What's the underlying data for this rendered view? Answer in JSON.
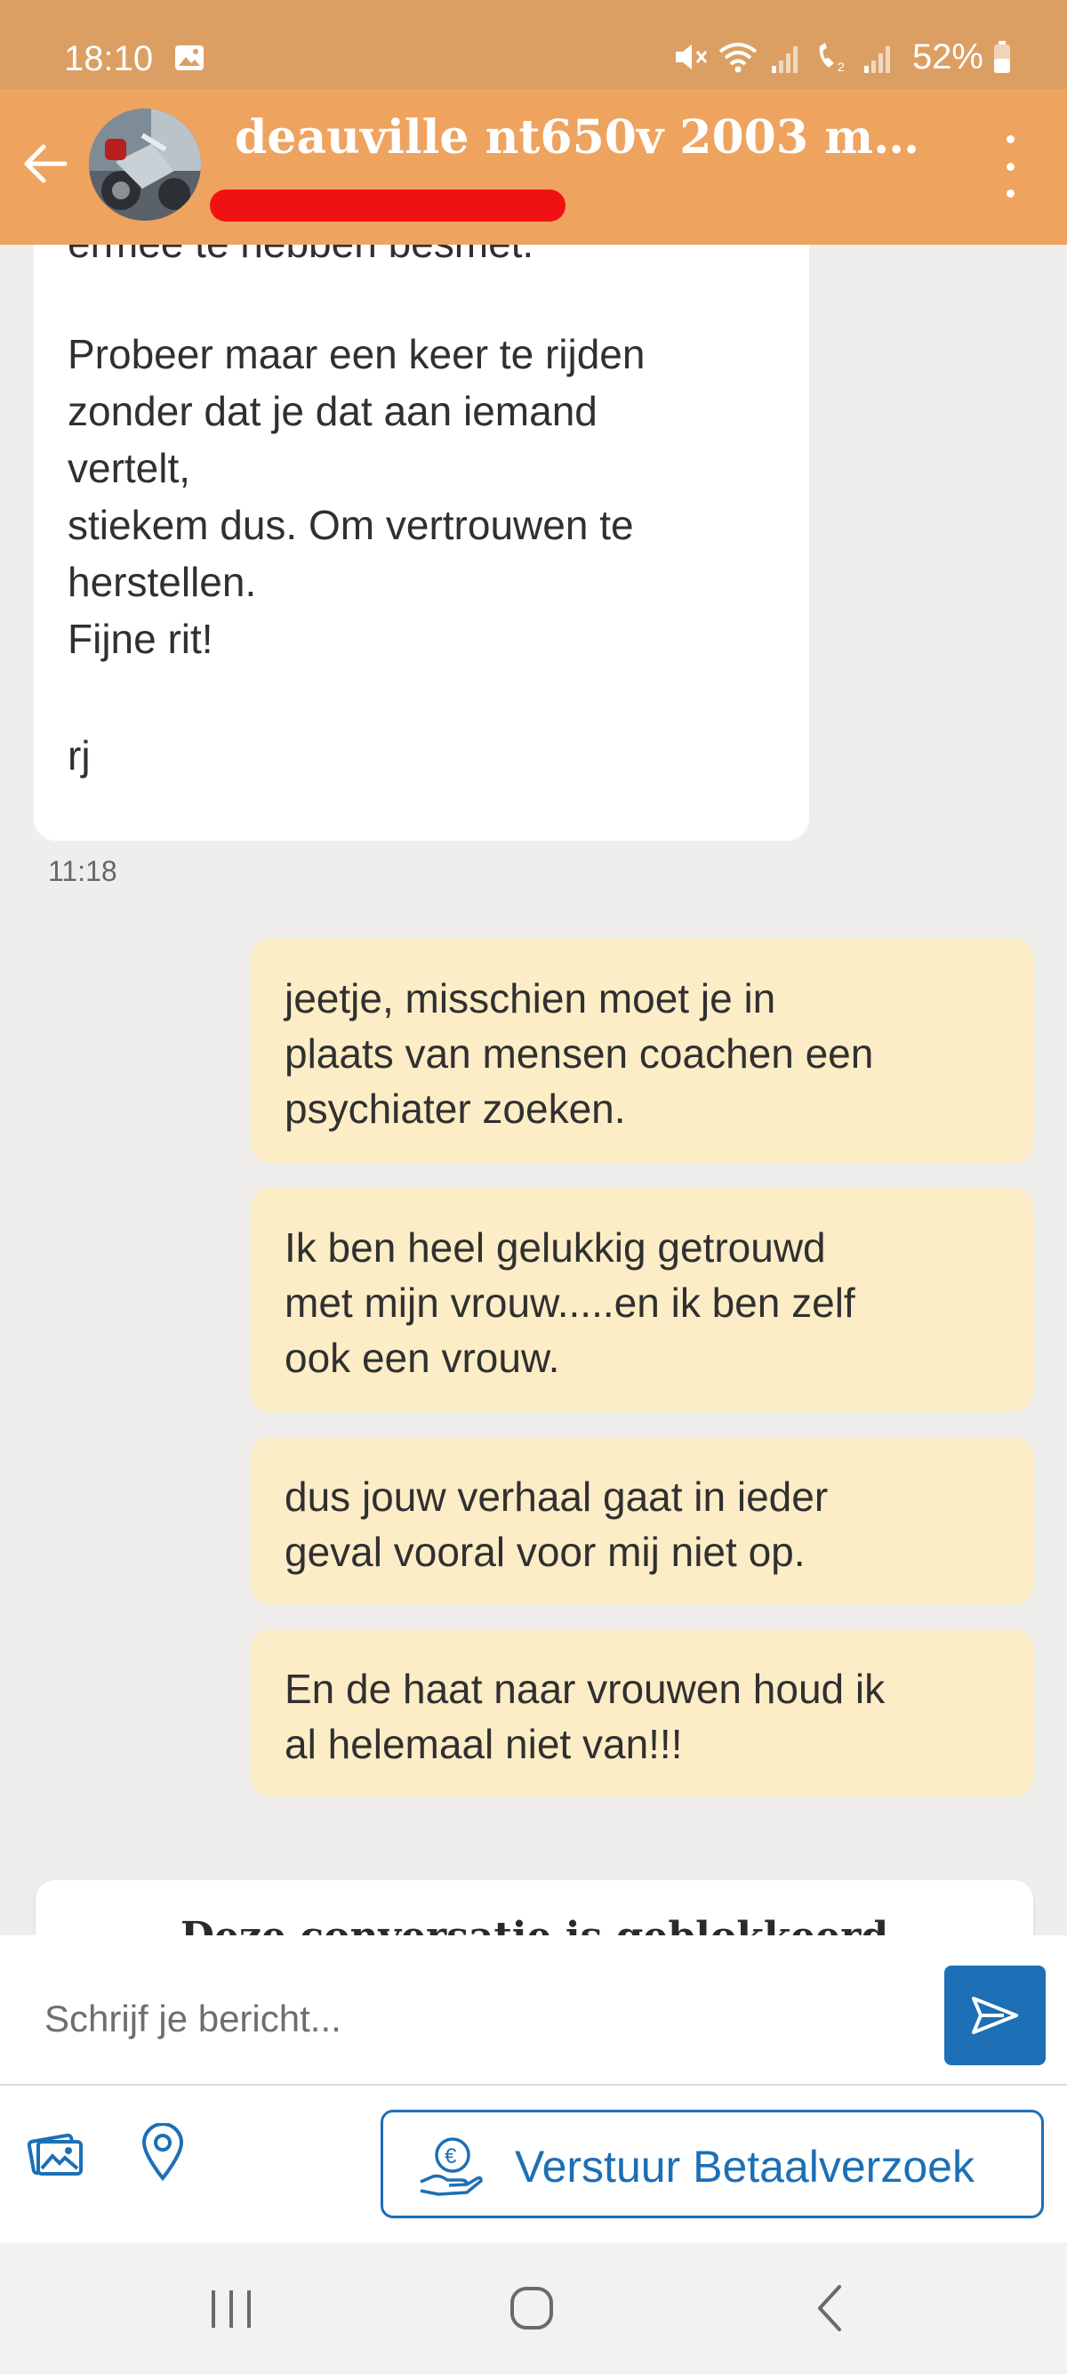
{
  "status_bar": {
    "time": "18:10",
    "battery": "52%"
  },
  "header": {
    "title": "deauville nt650v  2003 mo...",
    "avatar_icon": "motorcycle-photo",
    "back_icon": "back-arrow-icon",
    "menu_icon": "more-vert-icon"
  },
  "messages": {
    "incoming": {
      "top_line": "ermee te hebben besmet.",
      "body": "Probeer maar een keer te rijden\nzonder dat je dat aan iemand\nvertelt,\nstiekem dus. Om vertrouwen te\nherstellen.\nFijne rit!",
      "signature": "rj",
      "time": "11:18"
    },
    "outgoing": [
      {
        "text": "jeetje, misschien moet je in\nplaats van mensen coachen een\npsychiater zoeken."
      },
      {
        "text": "Ik ben heel gelukkig getrouwd\nmet mijn vrouw.....en ik ben zelf\nook een vrouw."
      },
      {
        "text": "dus jouw verhaal gaat in ieder\ngeval vooral voor mij niet op."
      },
      {
        "text": "En de haat naar vrouwen houd ik\nal helemaal niet van!!!"
      }
    ],
    "blocked_notice": "Deze conversatie is geblokkeerd"
  },
  "composer": {
    "placeholder": "Schrijf je bericht...",
    "pay_request_label": "Verstuur Betaalverzoek"
  },
  "colors": {
    "status_bar": "#dc9f63",
    "header": "#eea35f",
    "outgoing_bubble": "#fdedc7",
    "accent_blue": "#1d6fb6",
    "redaction": "#ef1212"
  }
}
